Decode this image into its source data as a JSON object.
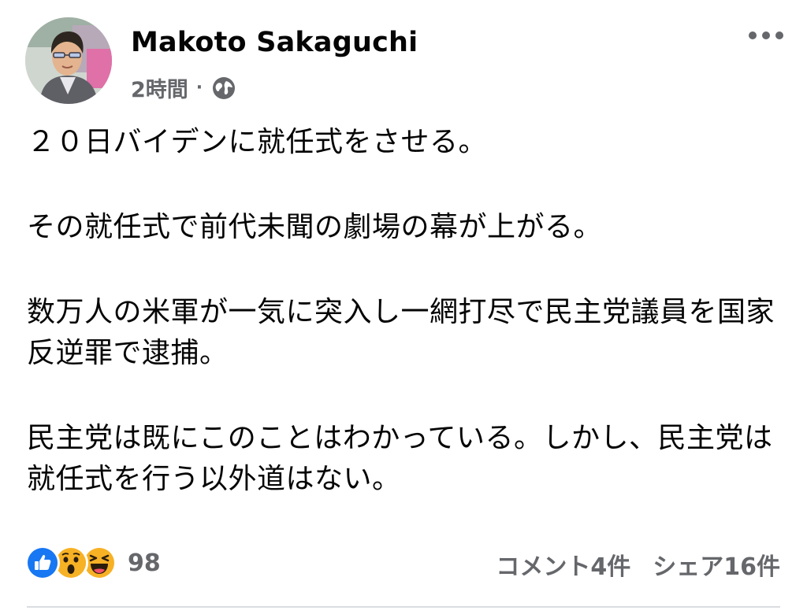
{
  "post": {
    "author": "Makoto Sakaguchi",
    "time": "2時間",
    "separator": "·",
    "audience_icon": "globe-icon",
    "more_icon": "more-horizontal-icon",
    "paragraphs": [
      "２０日バイデンに就任式をさせる。",
      "その就任式で前代未聞の劇場の幕が上がる。",
      "数万人の米軍が一気に突入し一網打尽で民主党議員を国家反逆罪で逮捕。",
      "民主党は既にこのことはわかっている。しかし、民主党は就任式を行う以外道はない。"
    ]
  },
  "engagement": {
    "reactions": [
      "like-icon",
      "wow-icon",
      "haha-icon"
    ],
    "reaction_count": "98",
    "comments": "コメント4件",
    "shares": "シェア16件"
  },
  "colors": {
    "like_blue": "#1877f2",
    "reaction_yellow": "#f7b125",
    "secondary_text": "#65676b",
    "divider": "#dadde1"
  }
}
